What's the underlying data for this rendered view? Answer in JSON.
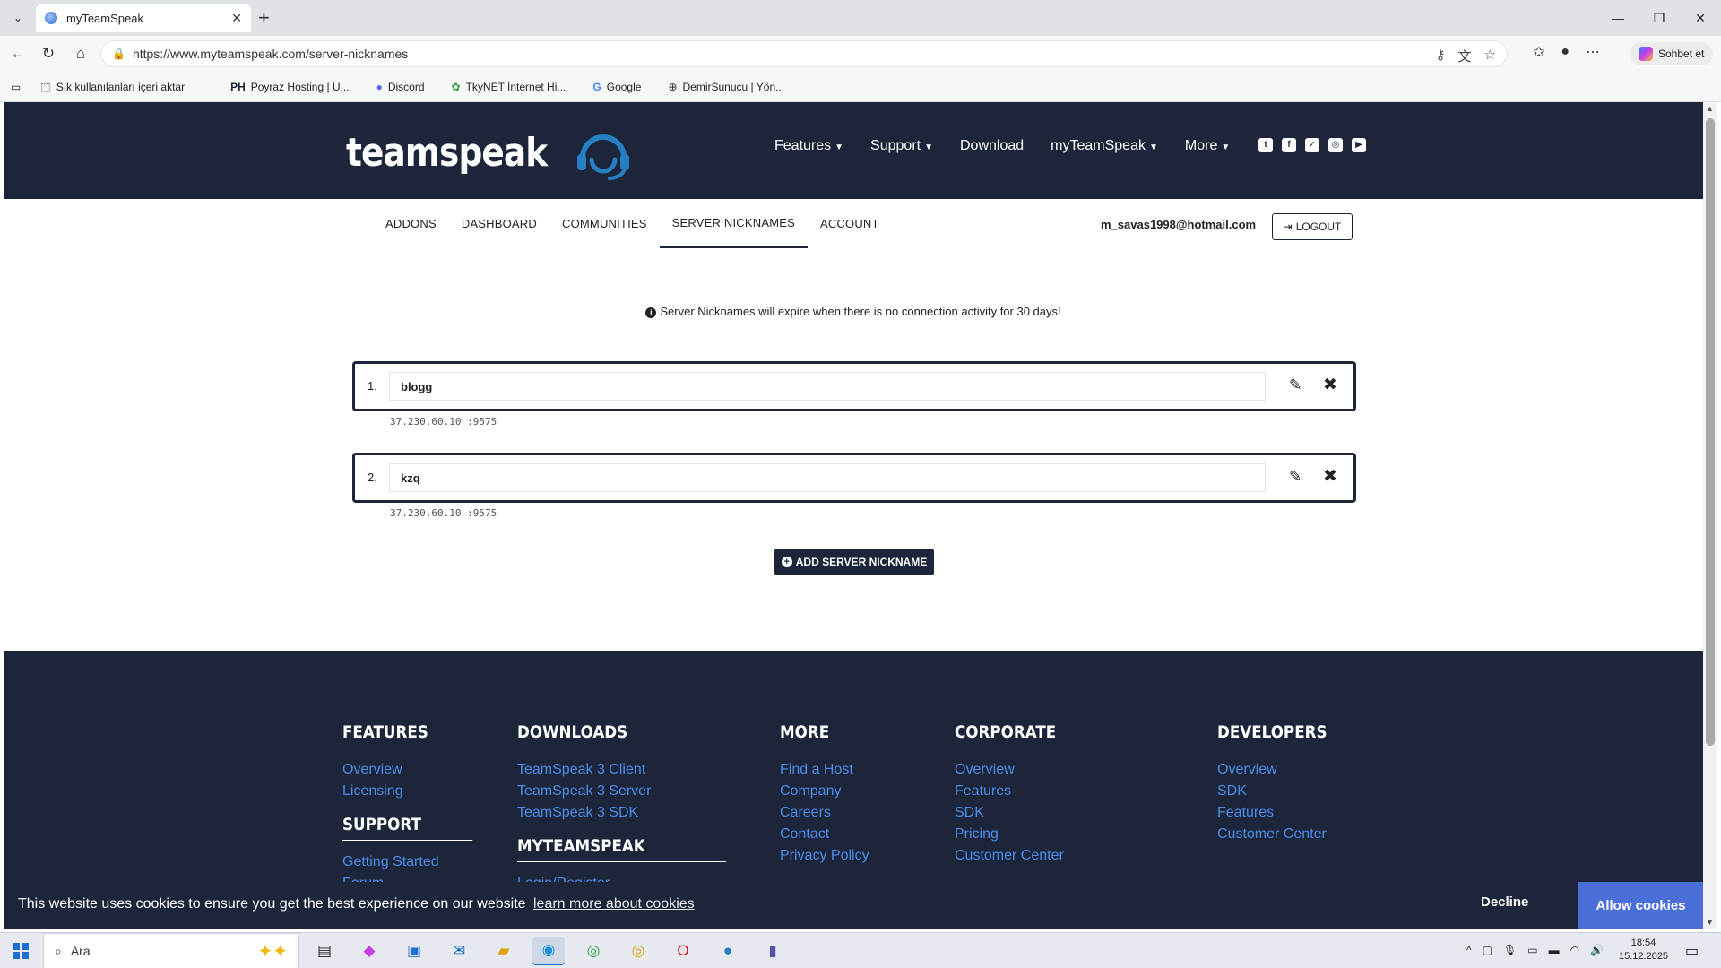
{
  "browser": {
    "tab_title": "myTeamSpeak",
    "url": "https://www.myteamspeak.com/server-nicknames",
    "copilot_label": "Sohbet et",
    "bookmarks": [
      {
        "label": "Sık kullanılanları içeri aktar",
        "icon": "import-icon"
      },
      {
        "label": "Poyraz Hosting | Ü...",
        "icon": "ph-logo"
      },
      {
        "label": "Discord",
        "icon": "discord-icon"
      },
      {
        "label": "TkyNET İnternet Hi...",
        "icon": "tkynet-icon"
      },
      {
        "label": "Google",
        "icon": "google-icon"
      },
      {
        "label": "DemirSunucu | Yön...",
        "icon": "globe-icon"
      }
    ]
  },
  "header": {
    "logo_text": "teamspeak",
    "nav": [
      {
        "label": "Features",
        "dropdown": true
      },
      {
        "label": "Support",
        "dropdown": true
      },
      {
        "label": "Download",
        "dropdown": false
      },
      {
        "label": "myTeamSpeak",
        "dropdown": true
      },
      {
        "label": "More",
        "dropdown": true
      }
    ],
    "socials": [
      "twitch-icon",
      "facebook-icon",
      "twitter-icon",
      "instagram-icon",
      "youtube-icon"
    ]
  },
  "subnav": {
    "items": [
      "ADDONS",
      "DASHBOARD",
      "COMMUNITIES",
      "SERVER NICKNAMES",
      "ACCOUNT"
    ],
    "active": "SERVER NICKNAMES",
    "email": "m_savas1998@hotmail.com",
    "logout_label": "LOGOUT"
  },
  "notice": "Server Nicknames will expire when there is no connection activity for 30 days!",
  "nicknames": [
    {
      "number": "1.",
      "name": "blogg",
      "address": "37.230.60.10 :9575"
    },
    {
      "number": "2.",
      "name": "kzq",
      "address": "37.230.60.10 :9575"
    }
  ],
  "add_button_label": "ADD SERVER NICKNAME",
  "footer": {
    "features": {
      "title": "FEATURES",
      "links": [
        "Overview",
        "Licensing"
      ]
    },
    "support": {
      "title": "SUPPORT",
      "links": [
        "Getting Started",
        "Forum"
      ]
    },
    "downloads": {
      "title": "DOWNLOADS",
      "links": [
        "TeamSpeak 3 Client",
        "TeamSpeak 3 Server",
        "TeamSpeak 3 SDK"
      ]
    },
    "myteamspeak": {
      "title": "MYTEAMSPEAK",
      "links": [
        "Login/Register"
      ]
    },
    "more": {
      "title": "MORE",
      "links": [
        "Find a Host",
        "Company",
        "Careers",
        "Contact",
        "Privacy Policy"
      ]
    },
    "corporate": {
      "title": "CORPORATE",
      "links": [
        "Overview",
        "Features",
        "SDK",
        "Pricing",
        "Customer Center"
      ]
    },
    "developers": {
      "title": "DEVELOPERS",
      "links": [
        "Overview",
        "SDK",
        "Features",
        "Customer Center"
      ]
    }
  },
  "cookie": {
    "text": "This website uses cookies to ensure you get the best experience on our website",
    "link": "learn more about cookies",
    "decline": "Decline",
    "allow": "Allow cookies"
  },
  "taskbar": {
    "search_placeholder": "Ara",
    "time": "18:54",
    "date": "15.12.2025"
  },
  "colors": {
    "brand_dark": "#1c2539",
    "link_blue": "#4a8de8",
    "allow_button": "#4a6fd8"
  }
}
